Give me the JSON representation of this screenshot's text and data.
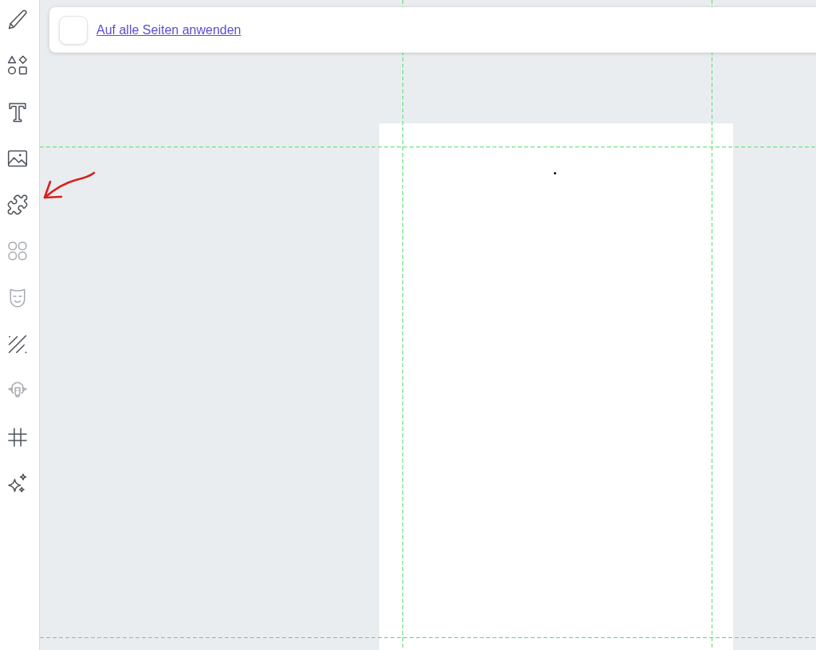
{
  "sidebar": {
    "items": [
      {
        "kind": "pencil",
        "disabled": false
      },
      {
        "kind": "shapes",
        "disabled": false
      },
      {
        "kind": "text",
        "disabled": false
      },
      {
        "kind": "image",
        "disabled": false
      },
      {
        "kind": "puzzle",
        "disabled": false
      },
      {
        "kind": "circles",
        "disabled": true
      },
      {
        "kind": "mask",
        "disabled": true
      },
      {
        "kind": "stripes",
        "disabled": false
      },
      {
        "kind": "sheep",
        "disabled": true
      },
      {
        "kind": "grid",
        "disabled": false
      },
      {
        "kind": "sparkles",
        "disabled": false
      }
    ]
  },
  "options_bar": {
    "apply_to_all": {
      "checked": false,
      "label": "Auf alle Seiten anwenden"
    }
  },
  "canvas": {
    "show_guides": true,
    "page": {
      "marks": [
        {
          "kind": "dot"
        }
      ]
    }
  },
  "annotations": [
    {
      "kind": "arrow"
    }
  ]
}
